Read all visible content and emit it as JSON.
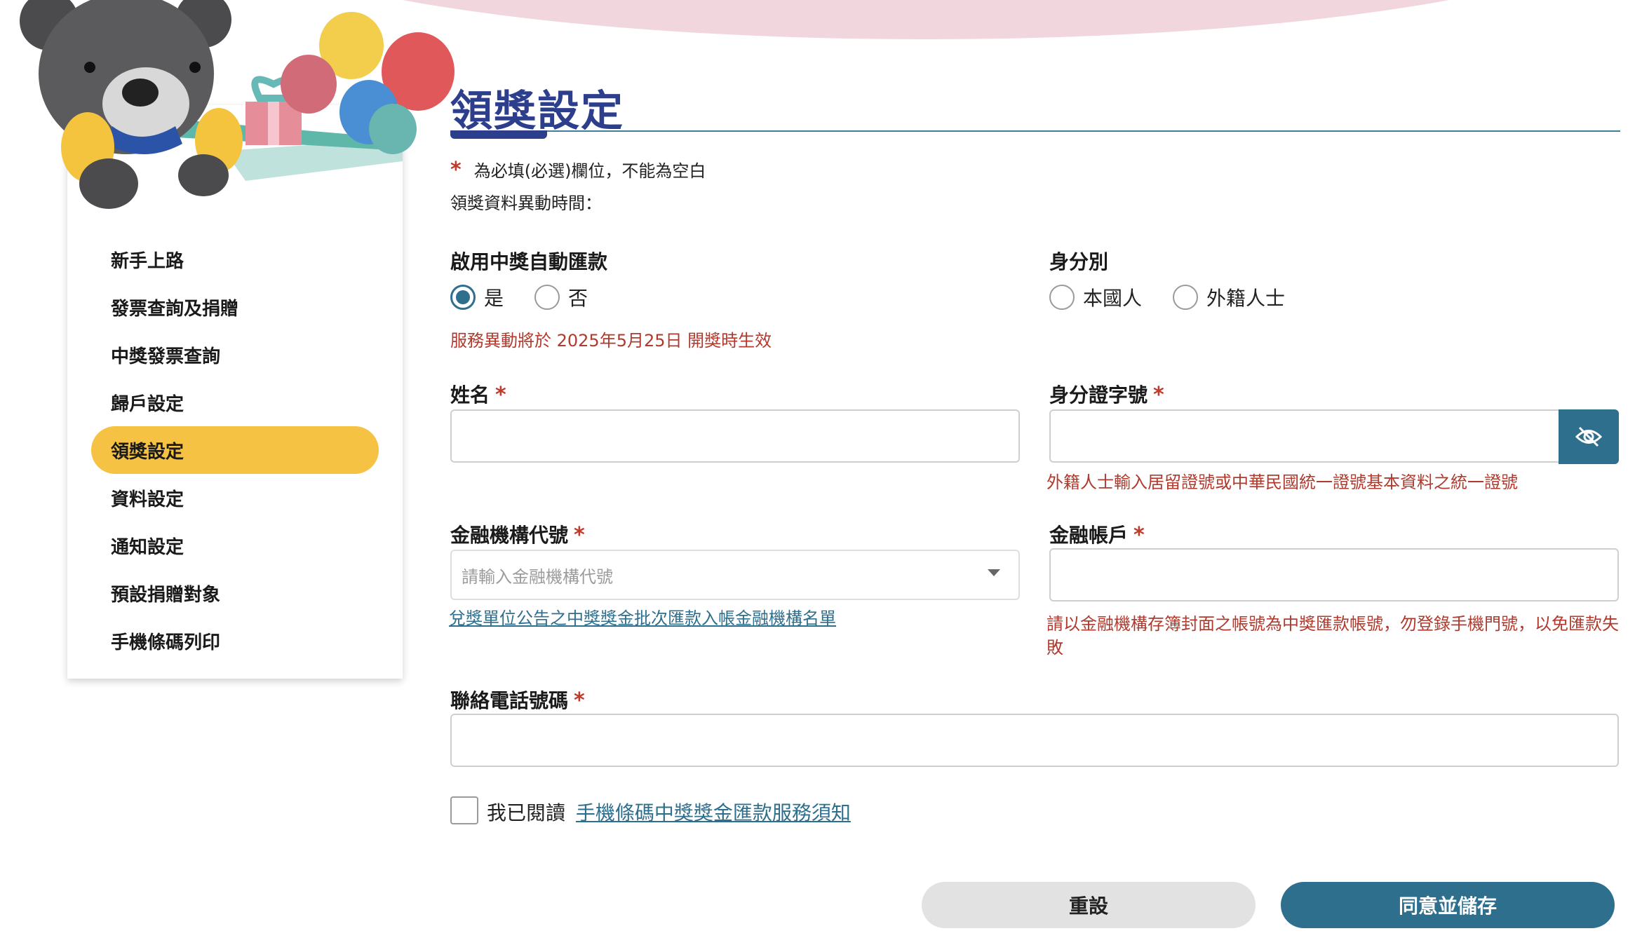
{
  "sidebar": {
    "items": [
      {
        "label": "新手上路"
      },
      {
        "label": "發票查詢及捐贈"
      },
      {
        "label": "中獎發票查詢"
      },
      {
        "label": "歸戶設定"
      },
      {
        "label": "領獎設定",
        "active": true
      },
      {
        "label": "資料設定"
      },
      {
        "label": "通知設定"
      },
      {
        "label": "預設捐贈對象"
      },
      {
        "label": "手機條碼列印"
      }
    ]
  },
  "page": {
    "title": "領獎設定",
    "required_note": "為必填(必選)欄位，不能為空白",
    "change_time_label": "領獎資料異動時間："
  },
  "form": {
    "auto_transfer": {
      "label": "啟用中獎自動匯款",
      "options": [
        "是",
        "否"
      ],
      "selected": "是",
      "hint": "服務異動將於 2025年5月25日 開獎時生效"
    },
    "identity": {
      "label": "身分別",
      "options": [
        "本國人",
        "外籍人士"
      ]
    },
    "name": {
      "label": "姓名",
      "value": ""
    },
    "id_number": {
      "label": "身分證字號",
      "value": "",
      "hint": "外籍人士輸入居留證號或中華民國統一證號基本資料之統一證號"
    },
    "bank_code": {
      "label": "金融機構代號",
      "placeholder": "請輸入金融機構代號",
      "link": "兌獎單位公告之中獎獎金批次匯款入帳金融機構名單"
    },
    "bank_account": {
      "label": "金融帳戶",
      "value": "",
      "hint_line1": "請以金融機構存簿封面之帳號為中獎匯款帳號，勿登錄手機門號，以免匯款失",
      "hint_line2": "敗"
    },
    "phone": {
      "label": "聯絡電話號碼",
      "value": ""
    },
    "agree": {
      "prefix": "我已閱讀",
      "link": "手機條碼中獎獎金匯款服務須知",
      "checked": false
    }
  },
  "buttons": {
    "reset": "重設",
    "save": "同意並儲存"
  },
  "colors": {
    "accent": "#2e6f8e",
    "highlight": "#f6c244",
    "title": "#2d3f8c",
    "error": "#b03a2e"
  },
  "icons": {
    "id_toggle": "eye-off-icon"
  }
}
